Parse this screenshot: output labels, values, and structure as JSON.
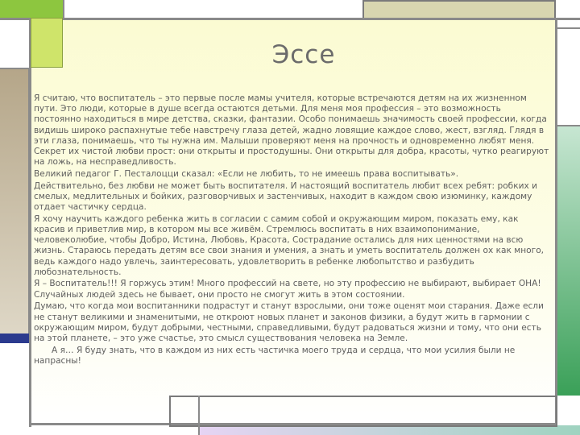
{
  "slide": {
    "title": "Эссе",
    "paragraphs": [
      "Я считаю, что воспитатель – это первые после мамы учителя, которые встречаются детям на их жизненном пути. Это люди, которые в душе всегда остаются детьми. Для меня моя профессия – это возможность постоянно находиться в мире детства, сказки, фантазии. Особо понимаешь значимость своей профессии, когда видишь широко распахнутые тебе навстречу глаза детей, жадно ловящие каждое слово, жест, взгляд. Глядя в эти глаза, понимаешь, что ты нужна им. Малыши проверяют меня на прочность и одновременно любят меня. Секрет их чистой любви прост: они открыты и простодушны. Они открыты для добра, красоты, чутко реагируют на ложь, на несправедливость.",
      "Великий педагог Г. Песталоцци сказал: «Если не любить, то не имеешь права воспитывать».",
      "Действительно, без любви не может быть воспитателя. И настоящий воспитатель любит всех ребят: робких и смелых, медлительных и бойких, разговорчивых и застенчивых, находит в каждом свою изюминку, каждому отдает частичку сердца.",
      "Я хочу научить каждого ребенка жить в согласии с самим собой и окружающим миром, показать ему, как красив и приветлив мир, в котором мы все живём. Стремлюсь воспитать в них взаимопонимание, человеколюбие, чтобы Добро, Истина, Любовь, Красота, Сострадание остались для них ценностями на всю жизнь. Стараюсь передать детям все свои знания и умения, а знать и уметь воспитатель должен ох как много, ведь каждого надо увлечь, заинтересовать, удовлетворить в ребенке любопытство и разбудить любознательность.",
      "Я – Воспитатель!!! Я горжусь этим! Много профессий на свете, но эту профессию не выбирают, выбирает ОНА! Случайных людей здесь не бывает, они просто не смогут жить в этом состоянии.",
      "Думаю, что когда мои воспитанники подрастут и станут взрослыми, они тоже оценят мои старания. Даже если не станут великими и знаменитыми, не откроют новых планет и законов физики, а будут жить в гармонии с окружающим миром, будут добрыми, честными, справедливыми, будут радоваться жизни и тому, что они есть на этой планете, – это уже счастье, это смысл существования человека на Земле.",
      "А я… Я буду знать, что в каждом из них есть частичка моего труда и сердца, что мои усилия были не напрасны!"
    ]
  },
  "colors": {
    "accent_green": "#8dc63f",
    "lime": "#cfe46a",
    "frame_gray": "#8a8a8a",
    "text_gray": "#5e5e5e"
  }
}
